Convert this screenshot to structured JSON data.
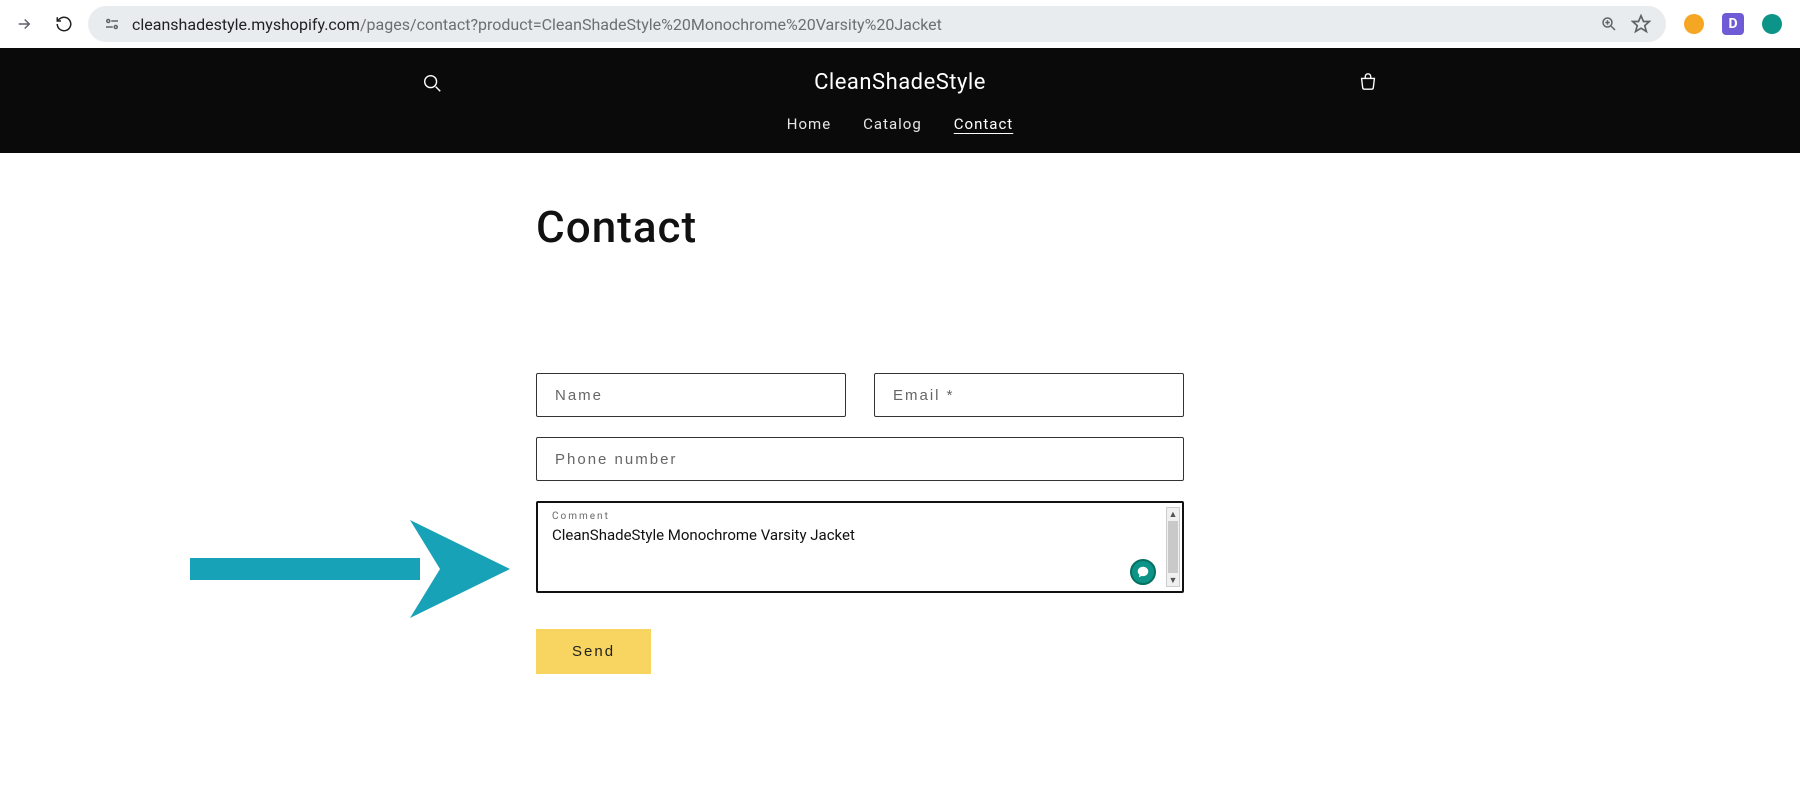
{
  "browser": {
    "url_host": "cleanshadestyle.myshopify.com",
    "url_path": "/pages/contact?product=CleanShadeStyle%20Monochrome%20Varsity%20Jacket",
    "ext_d_label": "D"
  },
  "header": {
    "brand": "CleanShadeStyle",
    "nav": {
      "home": "Home",
      "catalog": "Catalog",
      "contact": "Contact"
    }
  },
  "page": {
    "title": "Contact"
  },
  "form": {
    "name_placeholder": "Name",
    "email_placeholder": "Email *",
    "phone_placeholder": "Phone number",
    "comment_label": "Comment",
    "comment_value": "CleanShadeStyle Monochrome Varsity Jacket",
    "send_label": "Send"
  },
  "colors": {
    "arrow": "#17a2b8",
    "send_bg": "#f7d560",
    "ext_orange": "#f5a623",
    "ext_purple": "#6f5bd6",
    "ext_green": "#0d9488"
  }
}
